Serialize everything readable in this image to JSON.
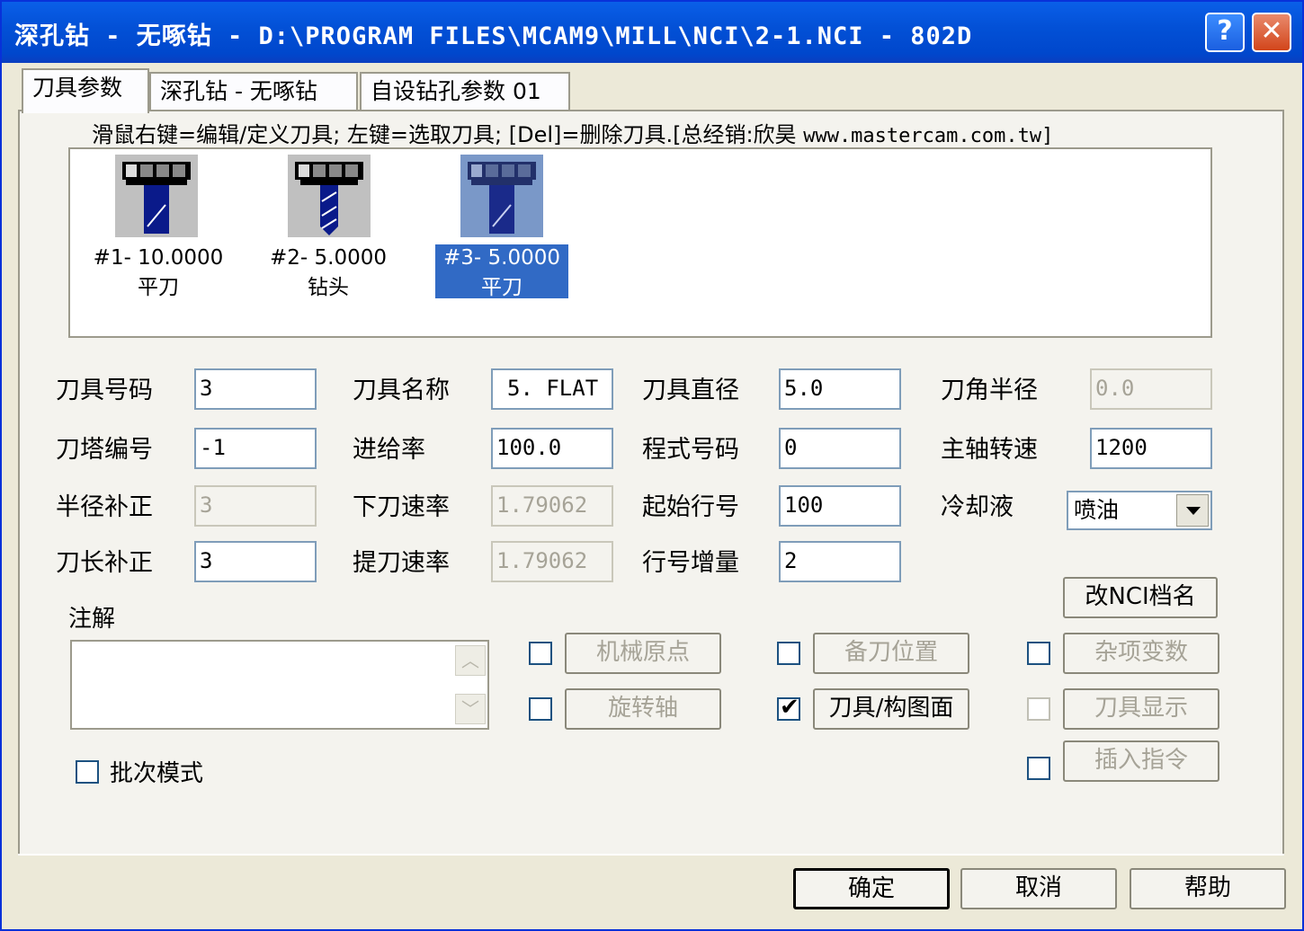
{
  "window": {
    "title": "深孔钻 - 无啄钻 - D:\\PROGRAM FILES\\MCAM9\\MILL\\NCI\\2-1.NCI - 802D",
    "help_btn": "?",
    "close_btn": "✕"
  },
  "tabs": [
    {
      "label": "刀具参数"
    },
    {
      "label": "深孔钻 - 无啄钻"
    },
    {
      "label": "自设钻孔参数 01"
    }
  ],
  "hint": {
    "text": "滑鼠右键=编辑/定义刀具; 左键=选取刀具; [Del]=删除刀具.[总经销:欣昊 ",
    "url": "www.mastercam.com.tw]"
  },
  "tools": [
    {
      "line1": "#1- 10.0000",
      "line2": "平刀"
    },
    {
      "line1": "#2- 5.0000",
      "line2": "钻头"
    },
    {
      "line1": "#3- 5.0000",
      "line2": "平刀"
    }
  ],
  "fields": {
    "tool_no": {
      "label": "刀具号码",
      "value": "3"
    },
    "tool_name": {
      "label": "刀具名称",
      "value": "5. FLAT"
    },
    "tool_dia": {
      "label": "刀具直径",
      "value": "5.0"
    },
    "corner_r": {
      "label": "刀角半径",
      "value": "0.0"
    },
    "turret_no": {
      "label": "刀塔编号",
      "value": "-1"
    },
    "feed": {
      "label": "进给率",
      "value": "100.0"
    },
    "program_no": {
      "label": "程式号码",
      "value": "0"
    },
    "spindle": {
      "label": "主轴转速",
      "value": "1200"
    },
    "radius_comp": {
      "label": "半径补正",
      "value": "3"
    },
    "plunge": {
      "label": "下刀速率",
      "value": "1.79062"
    },
    "seq_start": {
      "label": "起始行号",
      "value": "100"
    },
    "coolant": {
      "label": "冷却液",
      "value": "喷油"
    },
    "length_comp": {
      "label": "刀长补正",
      "value": "3"
    },
    "retract": {
      "label": "提刀速率",
      "value": "1.79062"
    },
    "seq_inc": {
      "label": "行号增量",
      "value": "2"
    }
  },
  "comment_label": "注解",
  "buttons": {
    "rename_nci": "改NCI档名",
    "home_pos": "机械原点",
    "ref_point": "备刀位置",
    "misc_vars": "杂项变数",
    "rotary_axis": "旋转轴",
    "tool_plane": "刀具/构图面",
    "tool_display": "刀具显示",
    "insert_cmd": "插入指令",
    "ok": "确定",
    "cancel": "取消",
    "help": "帮助"
  },
  "batch_mode": "批次模式",
  "check_mark": "✔"
}
